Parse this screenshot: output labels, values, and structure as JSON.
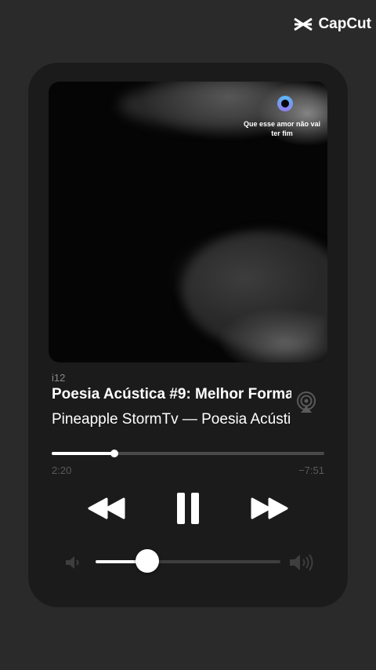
{
  "watermark": {
    "brand": "CapCut",
    "icon": "capcut-logo-icon"
  },
  "artwork": {
    "caption": "Que esse amor não vai ter fim",
    "icon": "story-swirl-icon"
  },
  "now_playing": {
    "source": "i12",
    "title": "Poesia Acústica #9: Melhor Forma",
    "artist_line": "Pineapple StormTv — Poesia Acústica",
    "airplay_icon": "airplay-icon"
  },
  "playback": {
    "progress": 0.23,
    "elapsed": "2:20",
    "remaining": "−7:51"
  },
  "controls": {
    "rewind_icon": "rewind-icon",
    "pause_icon": "pause-icon",
    "forward_icon": "fast-forward-icon"
  },
  "volume": {
    "level": 0.28,
    "low_icon": "volume-low-icon",
    "high_icon": "volume-high-icon"
  },
  "colors": {
    "background": "#2a2a2a",
    "card": "#1b1b1b",
    "accent": "#ffffff",
    "muted": "#5a5a5a"
  }
}
